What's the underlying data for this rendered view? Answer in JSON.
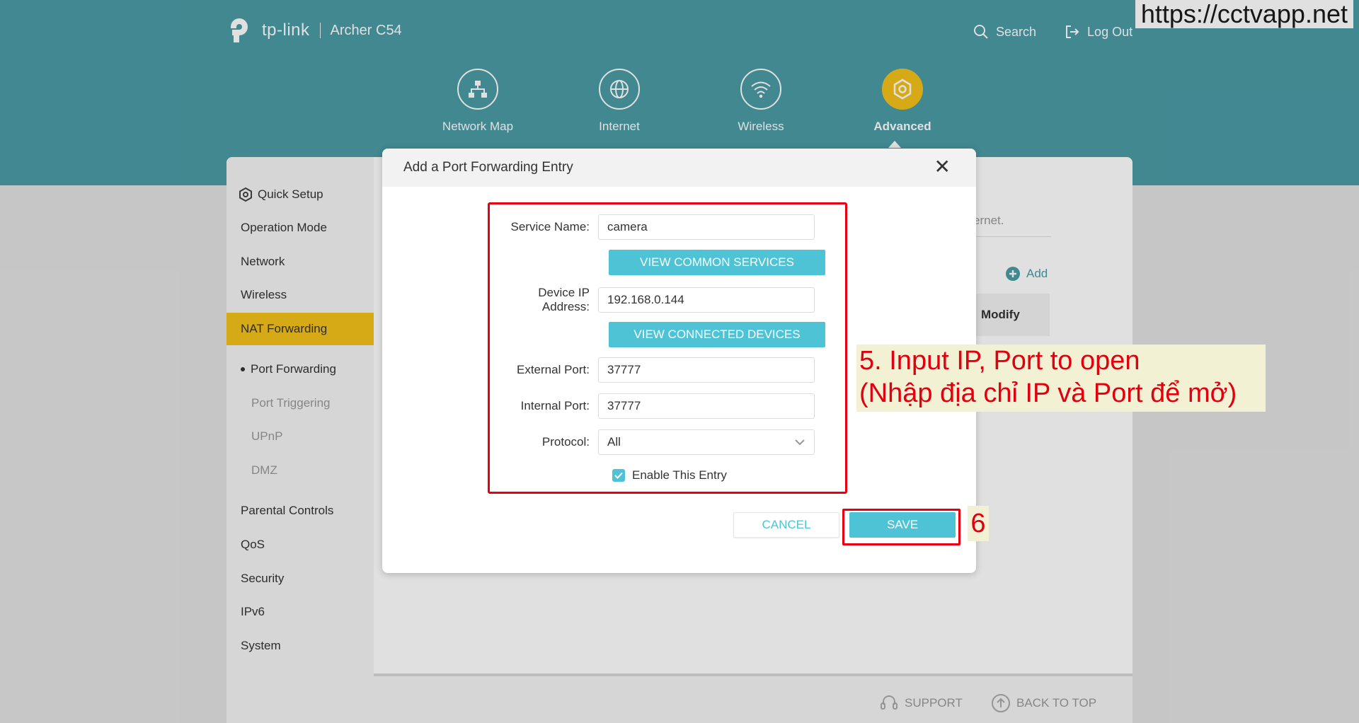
{
  "header": {
    "brand": "tp-link",
    "model": "Archer C54",
    "search_label": "Search",
    "logout_label": "Log Out"
  },
  "watermark": "https://cctvapp.net",
  "nav": {
    "items": [
      {
        "label": "Network Map",
        "icon": "network-map-icon"
      },
      {
        "label": "Internet",
        "icon": "globe-icon"
      },
      {
        "label": "Wireless",
        "icon": "wifi-icon"
      },
      {
        "label": "Advanced",
        "icon": "gear-icon",
        "active": true
      }
    ]
  },
  "sidebar": {
    "items": [
      {
        "label": "Quick Setup"
      },
      {
        "label": "Operation Mode"
      },
      {
        "label": "Network"
      },
      {
        "label": "Wireless"
      },
      {
        "label": "NAT Forwarding",
        "active": true
      },
      {
        "label": "Port Forwarding",
        "sub": true,
        "current": true
      },
      {
        "label": "Port Triggering",
        "sub": true
      },
      {
        "label": "UPnP",
        "sub": true
      },
      {
        "label": "DMZ",
        "sub": true
      },
      {
        "label": "Parental Controls"
      },
      {
        "label": "QoS"
      },
      {
        "label": "Security"
      },
      {
        "label": "IPv6"
      },
      {
        "label": "System"
      }
    ]
  },
  "main": {
    "hint_fragment": "ernet.",
    "add_label": "Add",
    "column_modify": "Modify"
  },
  "footer": {
    "support_label": "SUPPORT",
    "back_to_top_label": "BACK TO TOP"
  },
  "modal": {
    "title": "Add a Port Forwarding Entry",
    "close_glyph": "✕",
    "service_name_label": "Service Name:",
    "service_name_value": "camera",
    "view_common_services": "VIEW COMMON SERVICES",
    "device_ip_label": "Device IP Address:",
    "device_ip_value": "192.168.0.144",
    "view_connected_devices": "VIEW CONNECTED DEVICES",
    "external_port_label": "External Port:",
    "external_port_value": "37777",
    "internal_port_label": "Internal Port:",
    "internal_port_value": "37777",
    "protocol_label": "Protocol:",
    "protocol_value": "All",
    "enable_entry_label": "Enable This Entry",
    "enable_entry_checked": true,
    "cancel_label": "CANCEL",
    "save_label": "SAVE"
  },
  "annotations": {
    "step5_line1": "5. Input IP, Port to open",
    "step5_line2": "(Nhập địa chỉ IP và Port để mở)",
    "step6": "6"
  },
  "colors": {
    "header_bg": "#4a9ba6",
    "accent_yellow": "#f4c21b",
    "button_teal": "#4ec3d6",
    "annotation_red": "#e00010",
    "annotation_bg": "#f3f1d3"
  }
}
